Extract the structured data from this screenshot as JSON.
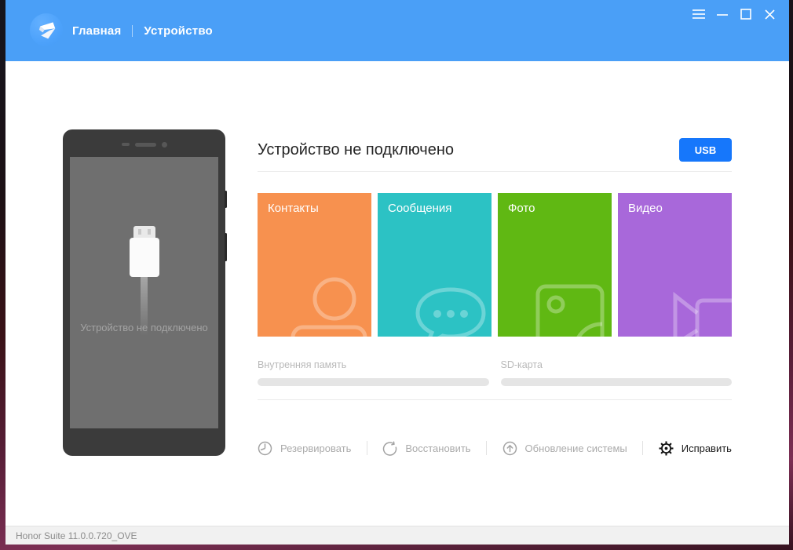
{
  "window": {
    "header": {
      "tabs": [
        {
          "label": "Главная",
          "active": true
        },
        {
          "label": "Устройство",
          "active": false
        }
      ],
      "controls": {
        "menu": "menu-icon",
        "minimize": "minimize-icon",
        "maximize": "maximize-icon",
        "close": "close-icon"
      }
    },
    "main": {
      "title": "Устройство не подключено",
      "usb_button": "USB",
      "phone": {
        "status_text": "Устройство не подключено"
      },
      "tiles": [
        {
          "label": "Контакты",
          "icon": "contacts-icon",
          "color": "#f7914f"
        },
        {
          "label": "Сообщения",
          "icon": "messages-icon",
          "color": "#2cc2c4"
        },
        {
          "label": "Фото",
          "icon": "photo-icon",
          "color": "#60b813"
        },
        {
          "label": "Видео",
          "icon": "video-icon",
          "color": "#a868da"
        }
      ],
      "storage": [
        {
          "label": "Внутренняя память",
          "progress_percent": 0
        },
        {
          "label": "SD-карта",
          "progress_percent": 0
        }
      ],
      "actions": [
        {
          "label": "Резервировать",
          "icon": "backup-icon",
          "enabled": false
        },
        {
          "label": "Восстановить",
          "icon": "restore-icon",
          "enabled": false
        },
        {
          "label": "Обновление системы",
          "icon": "system-update-icon",
          "enabled": false
        },
        {
          "label": "Исправить",
          "icon": "repair-gear-icon",
          "enabled": true
        }
      ]
    },
    "footer": {
      "version_text": "Honor Suite 11.0.0.720_OVE"
    }
  },
  "colors": {
    "header_blue": "#4a9ff7",
    "usb_button_blue": "#1677fb",
    "tile_orange": "#f7914f",
    "tile_teal": "#2cc2c4",
    "tile_green": "#60b813",
    "tile_purple": "#a868da"
  }
}
